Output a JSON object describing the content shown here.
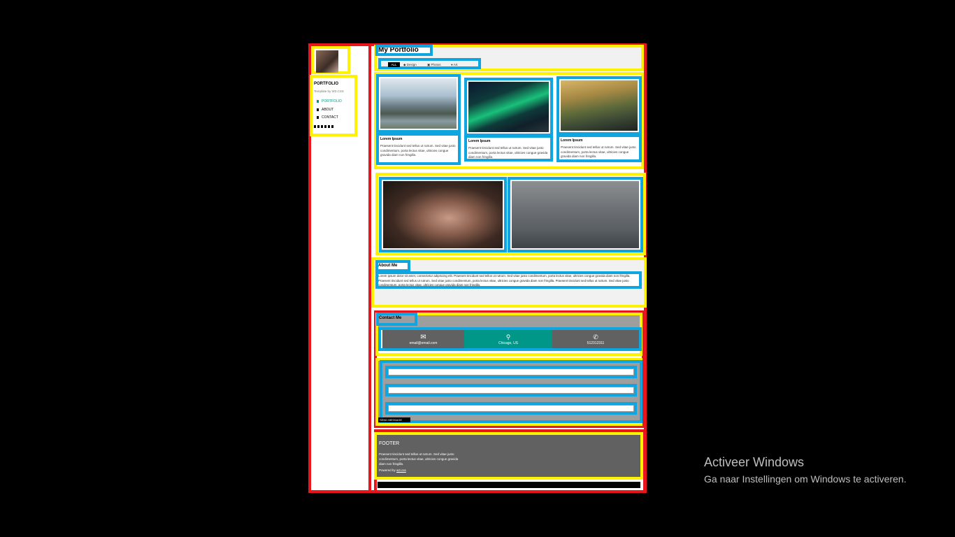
{
  "sidebar": {
    "brand": "PORTFOLIO",
    "subtitle": "Template by W3.CSS",
    "nav": [
      "PORTFOLIO",
      "ABOUT",
      "CONTACT"
    ],
    "social_icons": [
      "facebook-icon",
      "instagram-icon",
      "snapchat-icon",
      "pinterest-icon",
      "twitter-icon",
      "linkedin-icon"
    ]
  },
  "header": {
    "title": "My Portfolio",
    "filters": [
      "ALL",
      "Design",
      "Photos",
      "Art"
    ]
  },
  "cards": [
    {
      "title": "Lorem Ipsum",
      "text": "Praesent tincidunt sed tellus ut rutrum. Sed vitae justo condimentum, porta lectus vitae, ultricies congue gravida diam non fringilla."
    },
    {
      "title": "Lorem Ipsum",
      "text": "Praesent tincidunt sed tellus ut rutrum. Sed vitae justo condimentum, porta lectus vitae, ultricies congue gravida diam non fringilla."
    },
    {
      "title": "Lorem Ipsum",
      "text": "Praesent tincidunt sed tellus ut rutrum. Sed vitae justo condimentum, porta lectus vitae, ultricies congue gravida diam non fringilla."
    }
  ],
  "about": {
    "title": "About Me",
    "text": "Lorem ipsum dolor sit amet, consectetur adipiscing elit. Praesent tincidunt sed tellus ut rutrum. Sed vitae justo condimentum, porta lectus vitae, ultricies congue gravida diam non fringilla. Praesent tincidunt sed tellus ut rutrum. Sed vitae justo condimentum, porta lectus vitae, ultricies congue gravida diam non fringilla. Praesent tincidunt sed tellus ut rutrum. Sed vitae justo condimentum, porta lectus vitae, ultricies congue gravida diam non fringilla."
  },
  "contact": {
    "title": "Contact Me",
    "email": "email@email.com",
    "location": "Chicago, US",
    "phone": "512312311",
    "send_label": "SEND MESSAGE"
  },
  "footer": {
    "title": "FOOTER",
    "text": "Praesent tincidunt sed tellus ut rutrum. Sed vitae justo condimentum, porta lectus vitae, ultricies congue gravida diam non fringilla.",
    "powered_prefix": "Powered by ",
    "powered_link": "w3.css"
  },
  "watermark": {
    "title": "Activeer Windows",
    "subtitle": "Ga naar Instellingen om Windows te activeren."
  },
  "colors": {
    "accent": "#009688",
    "contact_bg": "#616161",
    "footer_bg": "#616161"
  }
}
